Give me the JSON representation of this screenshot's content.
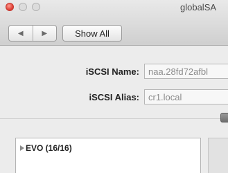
{
  "window": {
    "title": "globalSA"
  },
  "toolbar": {
    "back_icon": "◀",
    "forward_icon": "▶",
    "show_all_label": "Show All"
  },
  "form": {
    "iscsi_name_label": "iSCSI Name:",
    "iscsi_name_value": "naa.28fd72afbl",
    "iscsi_alias_label": "iSCSI Alias:",
    "iscsi_alias_value": "cr1.local"
  },
  "targets": {
    "items": [
      {
        "label": "EVO (16/16)"
      }
    ]
  }
}
